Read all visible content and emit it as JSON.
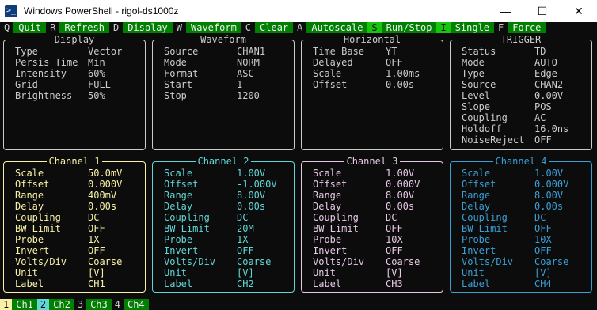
{
  "window": {
    "title": "Windows PowerShell - rigol-ds1000z",
    "icon_text": ">_",
    "minimize": "—",
    "maximize": "☐",
    "close": "✕"
  },
  "menu": [
    {
      "key": "Q",
      "label": "Quit"
    },
    {
      "key": "R",
      "label": "Refresh"
    },
    {
      "key": "D",
      "label": "Display"
    },
    {
      "key": "W",
      "label": "Waveform"
    },
    {
      "key": "C",
      "label": "Clear"
    },
    {
      "key": "A",
      "label": "Autoscale"
    },
    {
      "key": "S",
      "label": "Run/Stop"
    },
    {
      "key": "I",
      "label": "Single"
    },
    {
      "key": "F",
      "label": "Force"
    }
  ],
  "display": {
    "title": "Display",
    "rows": [
      [
        "Type",
        "Vector"
      ],
      [
        "Persis Time",
        "Min"
      ],
      [
        "Intensity",
        "60%"
      ],
      [
        "Grid",
        "FULL"
      ],
      [
        "Brightness",
        "50%"
      ]
    ]
  },
  "waveform": {
    "title": "Waveform",
    "rows": [
      [
        "Source",
        "CHAN1"
      ],
      [
        "Mode",
        "NORM"
      ],
      [
        "Format",
        "ASC"
      ],
      [
        "Start",
        "1"
      ],
      [
        "Stop",
        "1200"
      ]
    ]
  },
  "horizontal": {
    "title": "Horizontal",
    "rows": [
      [
        "Time Base",
        "YT"
      ],
      [
        "Delayed",
        "OFF"
      ],
      [
        "Scale",
        "1.00ms"
      ],
      [
        "Offset",
        "0.00s"
      ]
    ]
  },
  "trigger": {
    "title": "TRIGGER",
    "rows": [
      [
        "Status",
        "TD"
      ],
      [
        "Mode",
        "AUTO"
      ],
      [
        "Type",
        "Edge"
      ],
      [
        "Source",
        "CHAN2"
      ],
      [
        "Level",
        "0.00V"
      ],
      [
        "Slope",
        "POS"
      ],
      [
        "Coupling",
        "AC"
      ],
      [
        "Holdoff",
        "16.0ns"
      ],
      [
        "NoiseReject",
        "OFF"
      ]
    ]
  },
  "channels": [
    {
      "title": "Channel 1",
      "color": "#f9f1a5",
      "rows": [
        [
          "Scale",
          "50.0mV"
        ],
        [
          "Offset",
          "0.000V"
        ],
        [
          "Range",
          "400mV"
        ],
        [
          "Delay",
          "0.00s"
        ],
        [
          "Coupling",
          "DC"
        ],
        [
          "BW Limit",
          "OFF"
        ],
        [
          "Probe",
          "1X"
        ],
        [
          "Invert",
          "OFF"
        ],
        [
          "Volts/Div",
          "Coarse"
        ],
        [
          "Unit",
          "[V]"
        ],
        [
          "Label",
          "CH1"
        ]
      ]
    },
    {
      "title": "Channel 2",
      "color": "#61d6d6",
      "rows": [
        [
          "Scale",
          "1.00V"
        ],
        [
          "Offset",
          "-1.000V"
        ],
        [
          "Range",
          "8.00V"
        ],
        [
          "Delay",
          "0.00s"
        ],
        [
          "Coupling",
          "DC"
        ],
        [
          "BW Limit",
          "20M"
        ],
        [
          "Probe",
          "1X"
        ],
        [
          "Invert",
          "OFF"
        ],
        [
          "Volts/Div",
          "Coarse"
        ],
        [
          "Unit",
          "[V]"
        ],
        [
          "Label",
          "CH2"
        ]
      ]
    },
    {
      "title": "Channel 3",
      "color": "#e8c8e8",
      "rows": [
        [
          "Scale",
          "1.00V"
        ],
        [
          "Offset",
          "0.000V"
        ],
        [
          "Range",
          "8.00V"
        ],
        [
          "Delay",
          "0.00s"
        ],
        [
          "Coupling",
          "DC"
        ],
        [
          "BW Limit",
          "OFF"
        ],
        [
          "Probe",
          "10X"
        ],
        [
          "Invert",
          "OFF"
        ],
        [
          "Volts/Div",
          "Coarse"
        ],
        [
          "Unit",
          "[V]"
        ],
        [
          "Label",
          "CH3"
        ]
      ]
    },
    {
      "title": "Channel 4",
      "color": "#3b9fd6",
      "rows": [
        [
          "Scale",
          "1.00V"
        ],
        [
          "Offset",
          "0.000V"
        ],
        [
          "Range",
          "8.00V"
        ],
        [
          "Delay",
          "0.00s"
        ],
        [
          "Coupling",
          "DC"
        ],
        [
          "BW Limit",
          "OFF"
        ],
        [
          "Probe",
          "10X"
        ],
        [
          "Invert",
          "OFF"
        ],
        [
          "Volts/Div",
          "Coarse"
        ],
        [
          "Unit",
          "[V]"
        ],
        [
          "Label",
          "CH4"
        ]
      ]
    }
  ],
  "status": [
    {
      "num": "1",
      "name": "Ch1",
      "num_bg": "#f9f1a5"
    },
    {
      "num": "2",
      "name": "Ch2",
      "num_bg": "#61d6d6"
    },
    {
      "num": "3",
      "name": "Ch3",
      "num_bg": "#0c0c0c"
    },
    {
      "num": "4",
      "name": "Ch4",
      "num_bg": "#0c0c0c"
    }
  ],
  "colors": {
    "menu_label_bg": "#008000",
    "menu_highlight_bg": "#16c60c",
    "panel_border": "#cccccc"
  }
}
